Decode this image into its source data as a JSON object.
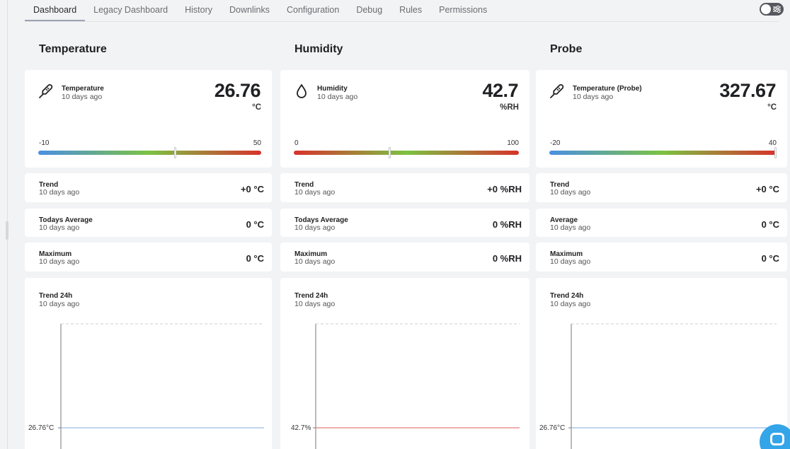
{
  "tabs": [
    {
      "label": "Dashboard",
      "active": true
    },
    {
      "label": "Legacy Dashboard"
    },
    {
      "label": "History"
    },
    {
      "label": "Downlinks"
    },
    {
      "label": "Configuration"
    },
    {
      "label": "Debug"
    },
    {
      "label": "Rules"
    },
    {
      "label": "Permissions"
    }
  ],
  "toolbar": {
    "settings_toggle_icon": "sliders-icon"
  },
  "columns": [
    {
      "title": "Temperature",
      "main": {
        "icon": "thermometer-icon",
        "name": "Temperature",
        "time": "10 days ago",
        "value": "26.76",
        "unit": "°C",
        "gauge_min": "-10",
        "gauge_max": "50",
        "gauge_fraction": 0.6127,
        "gauge_colors": [
          "#4a90e2",
          "#7cc242",
          "#d7322c"
        ]
      },
      "stats": [
        {
          "name": "Trend",
          "time": "10 days ago",
          "value": "+0 °C"
        },
        {
          "name": "Todays Average",
          "time": "10 days ago",
          "value": "0 °C"
        },
        {
          "name": "Maximum",
          "time": "10 days ago",
          "value": "0 °C"
        }
      ],
      "chart": {
        "title": "Trend 24h",
        "time": "10 days ago",
        "value_label": "26.76°C",
        "line_color": "#7fa9e6"
      }
    },
    {
      "title": "Humidity",
      "main": {
        "icon": "droplet-icon",
        "name": "Humidity",
        "time": "10 days ago",
        "value": "42.7",
        "unit": "%RH",
        "gauge_min": "0",
        "gauge_max": "100",
        "gauge_fraction": 0.427,
        "gauge_colors": [
          "#d7322c",
          "#7cc242",
          "#d7322c"
        ]
      },
      "stats": [
        {
          "name": "Trend",
          "time": "10 days ago",
          "value": "+0 %RH"
        },
        {
          "name": "Todays Average",
          "time": "10 days ago",
          "value": "0 %RH"
        },
        {
          "name": "Maximum",
          "time": "10 days ago",
          "value": "0 %RH"
        }
      ],
      "chart": {
        "title": "Trend 24h",
        "time": "10 days ago",
        "value_label": "42.7%",
        "line_color": "#e0605a"
      }
    },
    {
      "title": "Probe",
      "main": {
        "icon": "thermometer-icon",
        "name": "Temperature (Probe)",
        "time": "10 days ago",
        "value": "327.67",
        "unit": "°C",
        "gauge_min": "-20",
        "gauge_max": "40",
        "gauge_fraction": 1.0,
        "gauge_colors": [
          "#4a90e2",
          "#7cc242",
          "#d7322c"
        ]
      },
      "stats": [
        {
          "name": "Trend",
          "time": "10 days ago",
          "value": "+0 °C"
        },
        {
          "name": "Average",
          "time": "10 days ago",
          "value": "0 °C"
        },
        {
          "name": "Maximum",
          "time": "10 days ago",
          "value": "0 °C"
        }
      ],
      "chart": {
        "title": "Trend 24h",
        "time": "10 days ago",
        "value_label": "26.76°C",
        "line_color": "#7fa9e6"
      }
    }
  ],
  "chat": {
    "icon": "chat-icon"
  }
}
